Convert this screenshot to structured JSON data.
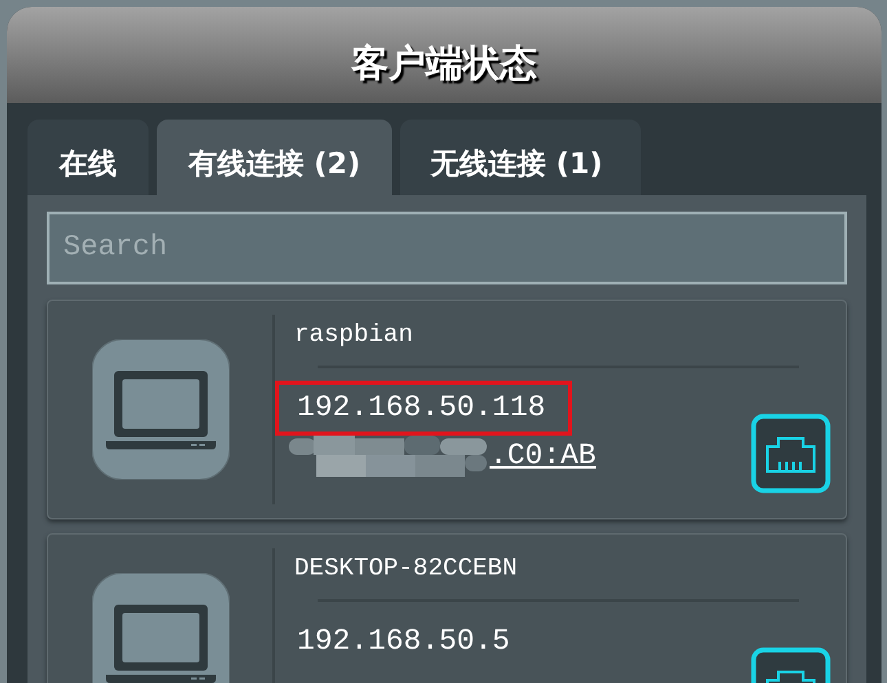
{
  "title": "客户端状态",
  "tabs": [
    {
      "label": "在线",
      "selected": false
    },
    {
      "label": "有线连接 (2)",
      "selected": true
    },
    {
      "label": "无线连接 (1)",
      "selected": false
    }
  ],
  "search": {
    "placeholder": "Search"
  },
  "clients": [
    {
      "name": "raspbian",
      "ip": "192.168.50.118",
      "highlighted": true,
      "mac": ".C0:AB",
      "mac_masked": true,
      "kind": "wired"
    },
    {
      "name": "DESKTOP-82CCEBN",
      "ip": "192.168.50.5",
      "highlighted": false,
      "kind": "wired"
    }
  ]
}
